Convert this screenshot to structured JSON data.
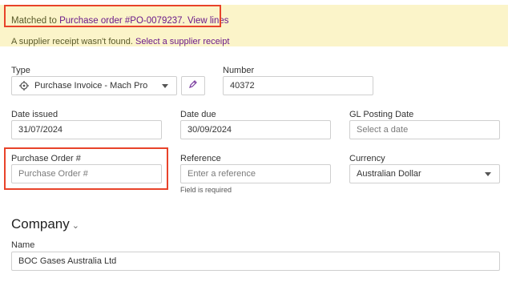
{
  "banner": {
    "matched_prefix": "Matched to ",
    "po_link": "Purchase order #PO-0079237.",
    "view_lines": "View lines",
    "receipt_text": "A supplier receipt wasn't found.",
    "receipt_link": "Select a supplier receipt"
  },
  "type": {
    "label": "Type",
    "value": "Purchase Invoice - Mach Pro"
  },
  "number": {
    "label": "Number",
    "value": "40372"
  },
  "date_issued": {
    "label": "Date issued",
    "value": "31/07/2024"
  },
  "date_due": {
    "label": "Date due",
    "value": "30/09/2024"
  },
  "gl_posting": {
    "label": "GL Posting Date",
    "placeholder": "Select a date"
  },
  "purchase_order": {
    "label": "Purchase Order #",
    "placeholder": "Purchase Order #"
  },
  "reference": {
    "label": "Reference",
    "placeholder": "Enter a reference",
    "hint": "Field is required"
  },
  "currency": {
    "label": "Currency",
    "value": "Australian Dollar"
  },
  "company": {
    "title": "Company",
    "name_label": "Name",
    "name_value": "BOC Gases Australia Ltd"
  },
  "colors": {
    "banner_bg": "#fbf4c9",
    "link": "#6b1a8a",
    "highlight": "#e8432a"
  }
}
